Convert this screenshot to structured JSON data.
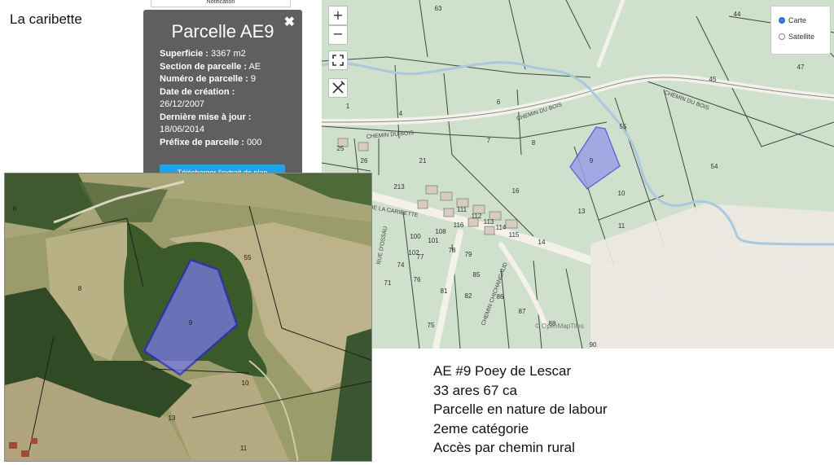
{
  "slide_title": "La caribette",
  "popup": {
    "top_fragment": "Notification",
    "title": "Parcelle AE9",
    "close_icon": "close-icon",
    "fields": [
      {
        "label": "Superficie :",
        "value": "3367 m2"
      },
      {
        "label": "Section de parcelle :",
        "value": "AE"
      },
      {
        "label": "Numéro de parcelle :",
        "value": "9"
      },
      {
        "label": "Date de création :",
        "value": "26/12/2007"
      },
      {
        "label": "Dernière mise à jour :",
        "value": "18/06/2014"
      },
      {
        "label": "Préfixe de parcelle :",
        "value": "000"
      }
    ],
    "download_button": "Télécharger l'extrait de plan"
  },
  "map_controls": {
    "zoom_in": "+",
    "zoom_out": "−",
    "fullscreen_icon": "fullscreen-icon",
    "measure_icon": "ruler-pencil-icon"
  },
  "layer_switcher": {
    "options": [
      {
        "label": "Carte",
        "selected": true
      },
      {
        "label": "Satellite",
        "selected": false
      }
    ]
  },
  "street_map": {
    "attribution": "© OpenMapTiles",
    "road_labels": [
      "CHEMIN DU BOIS",
      "CHEMIN DU BOIS",
      "CHEMIN DU BOIS",
      "DE LA CARIBETTE",
      "RUE D'OSSAU",
      "CHEMIN CHICHANGAUD"
    ],
    "parcel_numbers": [
      "63",
      "44",
      "47",
      "45",
      "1",
      "4",
      "6",
      "55",
      "8",
      "7",
      "25",
      "26",
      "21",
      "9",
      "54",
      "213",
      "16",
      "10",
      "13",
      "11",
      "14",
      "86",
      "87",
      "88",
      "75",
      "90",
      "71",
      "74",
      "76",
      "77",
      "78",
      "79",
      "81",
      "82",
      "85",
      "100",
      "101",
      "102",
      "108",
      "111",
      "112",
      "113",
      "114",
      "115",
      "116"
    ],
    "highlight_color": "#9a9fe6"
  },
  "satellite_map": {
    "parcel_numbers": [
      "6",
      "8",
      "55",
      "9",
      "10",
      "13",
      "11"
    ],
    "highlight_color": "#5a5ad6"
  },
  "notes": [
    "AE #9 Poey de Lescar",
    "33 ares 67 ca",
    "Parcelle en nature de labour",
    "2eme catégorie",
    "Accès par chemin rural"
  ]
}
